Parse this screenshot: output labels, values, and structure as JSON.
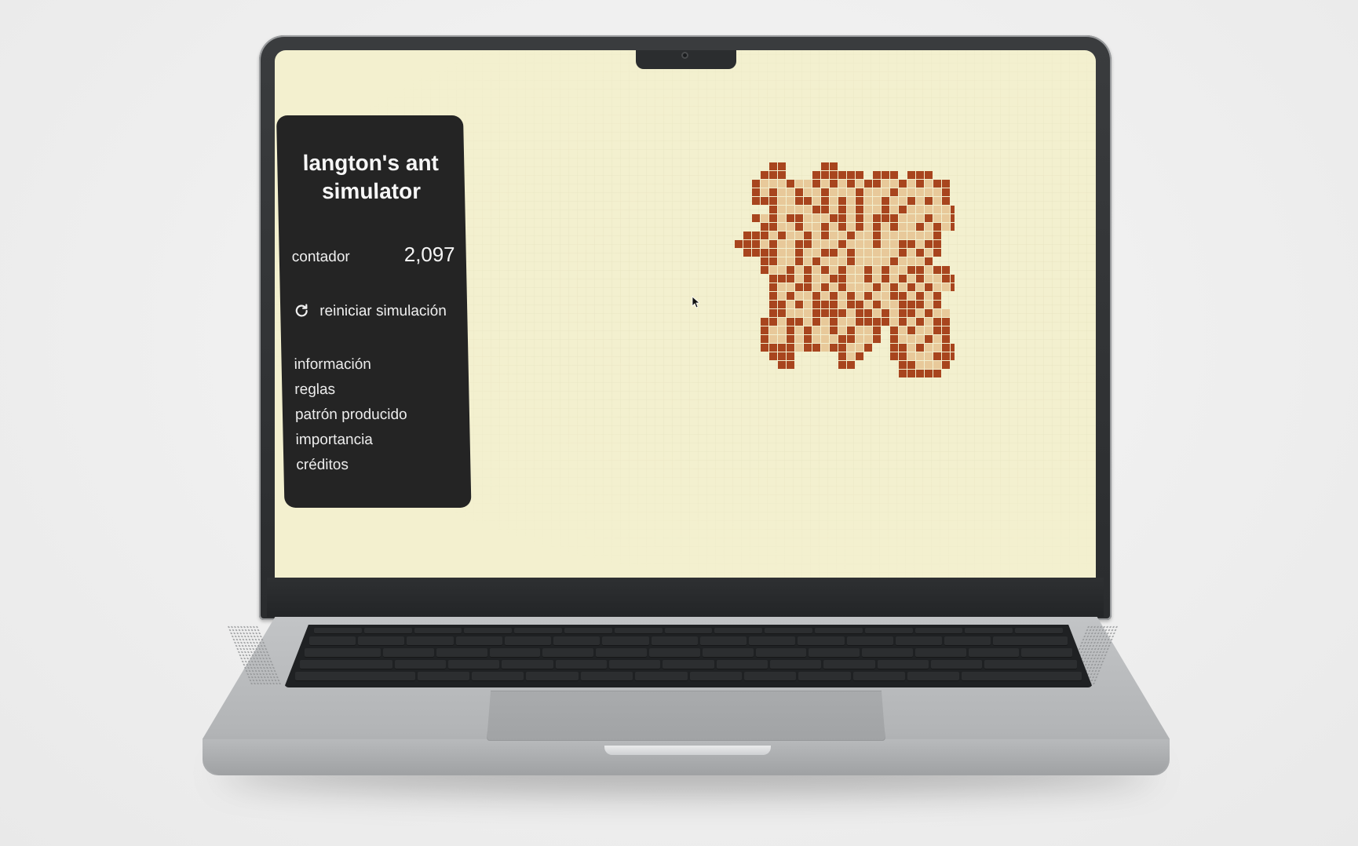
{
  "app": {
    "title": "langton's ant simulator",
    "counter": {
      "label": "contador",
      "value": "2,097"
    },
    "reset": {
      "icon": "refresh-icon",
      "label": "reiniciar simulación"
    },
    "menu": [
      {
        "label": "información"
      },
      {
        "label": "reglas"
      },
      {
        "label": "patrón producido"
      },
      {
        "label": "importancia"
      },
      {
        "label": "créditos"
      }
    ]
  },
  "colors": {
    "background": "#f3f0cf",
    "panel": "#242424",
    "cell_dark": "#a8451e",
    "cell_light": "#e8c99a"
  },
  "ant_grid": {
    "cols": 26,
    "rows": 25,
    "cells": [
      "....##....##..............",
      "...###...######.###.###...",
      "..#+++#++#+#+#+##++#+#+##.",
      "..#+#++#++#+++#+++#+++++#.",
      "..###++##+#+#+#++#++#+#+#.",
      "....#++++##+#+#++#+#+++++#",
      "..#+#+##+++##+#+###+++#++#",
      "...##++#++#+#+#+#+#++#+#+#",
      ".###+#++#+#++#++#++++++#..",
      "###+#++##+++#+++#++##+##..",
      ".####++#++##+#+++++#+#+#..",
      "...##++#+#+++#++++#+++#...",
      "...#++#+#+#+#++#+#++##+##.",
      "....###+#++##++#+#+#+#++##",
      "....#++##+#+#+++#+#+#+#++#",
      "....#+#++#+#+#+#++##+#+#.",
      "....##+#+###+##+#++###+#..",
      "....##+++####+##+#+##+#++.",
      "...##+##+#+#++####+#+#+##.",
      "...#++#+#++#+#++#.#+#++##.",
      "...#++#+#+++##++#.#+++#+#.",
      "...####+##+##++#..##+#++##",
      "....###.....#+#...##+++###",
      ".....##.....##.....##+++#.",
      "...................#####.."
    ]
  }
}
